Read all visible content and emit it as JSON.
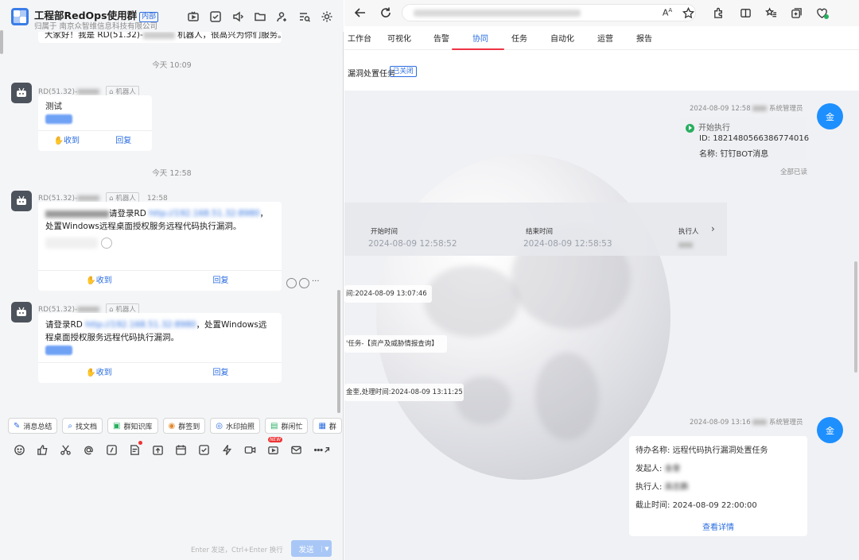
{
  "chat": {
    "group_title": "工程部RedOps使用群",
    "group_tag": "内部",
    "group_sub": "归属于 南京众智维信息科技有限公司",
    "header_icons": [
      "tv-icon",
      "checkbox-icon",
      "speaker-icon",
      "folder-icon",
      "add-user-icon",
      "search-list-icon",
      "settings-icon"
    ],
    "intro_text": "大家好！我是 RD(51.32)-",
    "intro_suffix": " 机器人，很高兴为你们服务。",
    "time1": "今天 10:09",
    "time2": "今天 12:58",
    "messages": [
      {
        "sender": "RD(51.32)-",
        "tag": "机器人",
        "time": "",
        "text": "测试"
      },
      {
        "sender": "RD(51.32)-",
        "tag": "机器人",
        "time": "12:58",
        "text_prefix": "请登录RD ",
        "link": "http://192.168.51.32:8980",
        "text_suffix": "，处置Windows远程桌面授权服务远程代码执行漏洞。"
      },
      {
        "sender": "RD(51.32)-",
        "tag": "机器人",
        "time": "",
        "text_prefix": "请登录RD ",
        "link": "http://192.168.51.32:8980",
        "text_suffix": "，处置Windows远程桌面授权服务远程代码执行漏洞。"
      }
    ],
    "action_received": "收到",
    "action_reply": "回复",
    "quick_buttons": [
      "消息总结",
      "找文档",
      "群知识库",
      "群签到",
      "水印拍照",
      "群闲忙",
      "群"
    ],
    "tools": [
      "emoji-icon",
      "thumb-icon",
      "scissors-icon",
      "at-icon",
      "slash-icon",
      "doc-icon",
      "upload-icon",
      "calendar-icon",
      "check-icon",
      "bolt-icon",
      "video-icon",
      "live-icon",
      "mail-icon",
      "more-icon"
    ],
    "new_tag": "NEW",
    "input_hint": "Enter 发送，Ctrl+Enter 换行",
    "send_label": "发送"
  },
  "browser": {
    "nav_tabs": [
      "工作台",
      "可视化",
      "告警",
      "协同",
      "任务",
      "自动化",
      "运营",
      "报告"
    ],
    "active_tab": "协同",
    "task_title": "漏洞处置任务",
    "task_status": "已关闭",
    "msg1": {
      "time": "2024-08-09 12:58",
      "role": "系统管理员",
      "avatar": "金",
      "status": "开始执行",
      "id_line": "ID: 1821480566386774016",
      "name_line": "名称: 钉钉BOT消息",
      "read": "全部已读"
    },
    "timeline": {
      "start_label": "开始时间",
      "end_label": "结束时间",
      "exec_label": "执行人",
      "start_value": "2024-08-09 12:58:52",
      "end_value": "2024-08-09 12:58:53"
    },
    "lines": [
      "间:2024-08-09 13:07:46",
      "'任务-【资产及威胁情报查询】",
      "金奎,处理时间:2024-08-09 13:11:25"
    ],
    "msg2": {
      "time": "2024-08-09 13:16",
      "role": "系统管理员",
      "avatar": "金",
      "todo_label": "待办名称: ",
      "todo_value": "远程代码执行漏洞处置任务",
      "initiator_label": "发起人: ",
      "initiator_value": "金奎",
      "executor_label": "执行人: ",
      "executor_value": "高志鹏",
      "deadline_label": "截止时间: ",
      "deadline_value": "2024-08-09 22:00:00",
      "detail_link": "查看详情"
    }
  },
  "colors": {
    "accent": "#2b6de0",
    "avatar_blue": "#1e8fff",
    "green": "#27ae60"
  }
}
